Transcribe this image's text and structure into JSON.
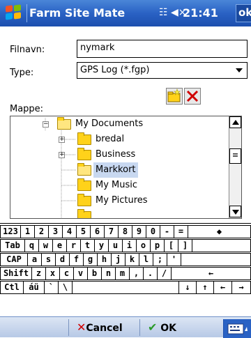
{
  "titlebar": {
    "app_title": "Farm Site Mate",
    "status_icons": "☷ ◀×",
    "clock": "21:41",
    "ok_label": "ok"
  },
  "form": {
    "filename_label": "Filnavn:",
    "filename_value": "nymark",
    "type_label": "Type:",
    "type_value": "GPS Log (*.fgp)",
    "folder_label": "Mappe:"
  },
  "tree": {
    "items": [
      {
        "label": "My Documents",
        "expander": "−"
      },
      {
        "label": "bredal",
        "expander": "+"
      },
      {
        "label": "Business",
        "expander": "+"
      },
      {
        "label": "Markkort",
        "expander": ""
      },
      {
        "label": "My Music",
        "expander": ""
      },
      {
        "label": "My Pictures",
        "expander": ""
      }
    ]
  },
  "keyboard": {
    "rows": [
      [
        "123",
        "1",
        "2",
        "3",
        "4",
        "5",
        "6",
        "7",
        "8",
        "9",
        "0",
        "-",
        "=",
        "◆"
      ],
      [
        "Tab",
        "q",
        "w",
        "e",
        "r",
        "t",
        "y",
        "u",
        "i",
        "o",
        "p",
        "[",
        "]"
      ],
      [
        "CAP",
        "a",
        "s",
        "d",
        "f",
        "g",
        "h",
        "j",
        "k",
        "l",
        ";",
        "'"
      ],
      [
        "Shift",
        "z",
        "x",
        "c",
        "v",
        "b",
        "n",
        "m",
        ",",
        ".",
        "/",
        "←"
      ],
      [
        "Ctl",
        "áü",
        "`",
        "\\",
        "",
        "↓",
        "↑",
        "←",
        "→"
      ]
    ]
  },
  "softkeys": {
    "cancel_label": "Cancel",
    "ok_label": "OK"
  },
  "colors": {
    "titlebar": "#2a62c4",
    "selection": "#c8d8f0",
    "cancel_x": "#d00000",
    "ok_check": "#2a9a2a"
  },
  "icons": {
    "new_folder": "new-folder-icon",
    "delete": "delete-icon"
  }
}
